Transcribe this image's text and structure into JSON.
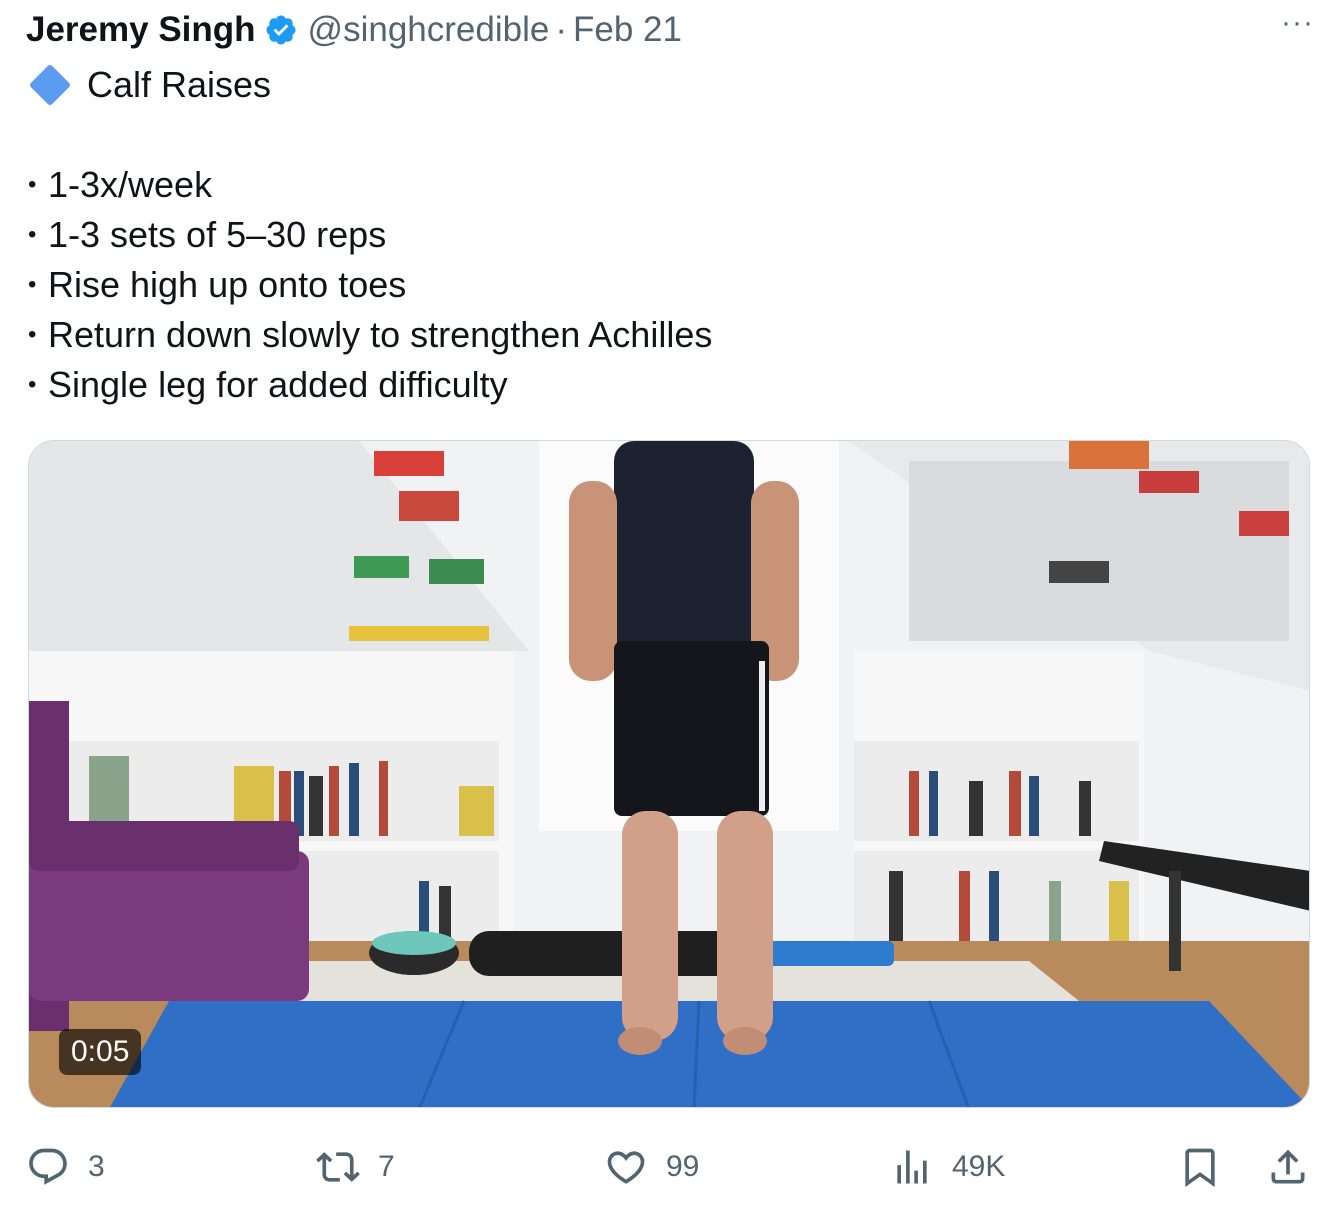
{
  "tweet": {
    "author_name": "Jeremy Singh",
    "handle": "@singhcredible",
    "separator": "·",
    "date": "Feb 21",
    "more": "···",
    "title": "Calf Raises",
    "bullets": [
      "1-3x/week",
      "1-3 sets of 5–30 reps",
      "Rise high up onto toes",
      "Return down slowly to strengthen Achilles",
      "Single leg for added difficulty"
    ],
    "bullet_symbol": "•",
    "video": {
      "timestamp": "0:05"
    }
  },
  "actions": {
    "replies": "3",
    "reposts": "7",
    "likes": "99",
    "views": "49K"
  },
  "colors": {
    "text": "#0f1419",
    "secondary": "#536471",
    "verified": "#1d9bf0",
    "diamond": "#5b9cf0"
  }
}
